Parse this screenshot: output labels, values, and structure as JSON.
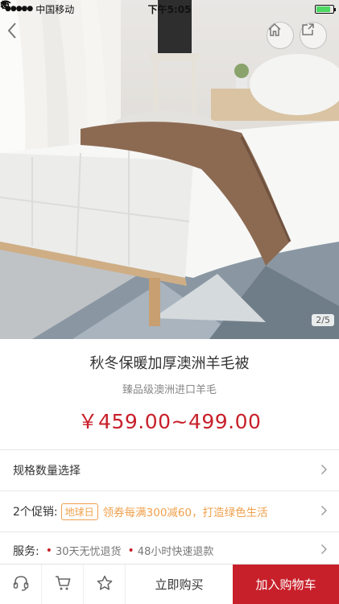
{
  "status_bar": {
    "carrier": "中国移动",
    "time": "下午5:05"
  },
  "hero": {
    "page_indicator": "2/5"
  },
  "product": {
    "title": "秋冬保暖加厚澳洲羊毛被",
    "subtitle": "臻品级澳洲进口羊毛",
    "price": "￥459.00~499.00"
  },
  "spec_row": {
    "label": "规格数量选择"
  },
  "promo_row": {
    "label": "2个促销:",
    "tag": "地球日",
    "text": "领券每满300减60，打造绿色生活"
  },
  "service_row": {
    "label": "服务:",
    "items": [
      "30天无忧退货",
      "48小时快速退款"
    ]
  },
  "bottom_bar": {
    "buy_now": "立即购买",
    "add_to_cart": "加入购物车"
  },
  "colors": {
    "accent": "#c8202a",
    "promo": "#f0a04b"
  },
  "icons": [
    "back-icon",
    "home-icon",
    "share-icon",
    "wifi-icon",
    "alarm-icon",
    "location-icon",
    "bluetooth-icon",
    "battery-icon",
    "support-icon",
    "cart-icon",
    "star-icon",
    "chevron-right-icon"
  ]
}
